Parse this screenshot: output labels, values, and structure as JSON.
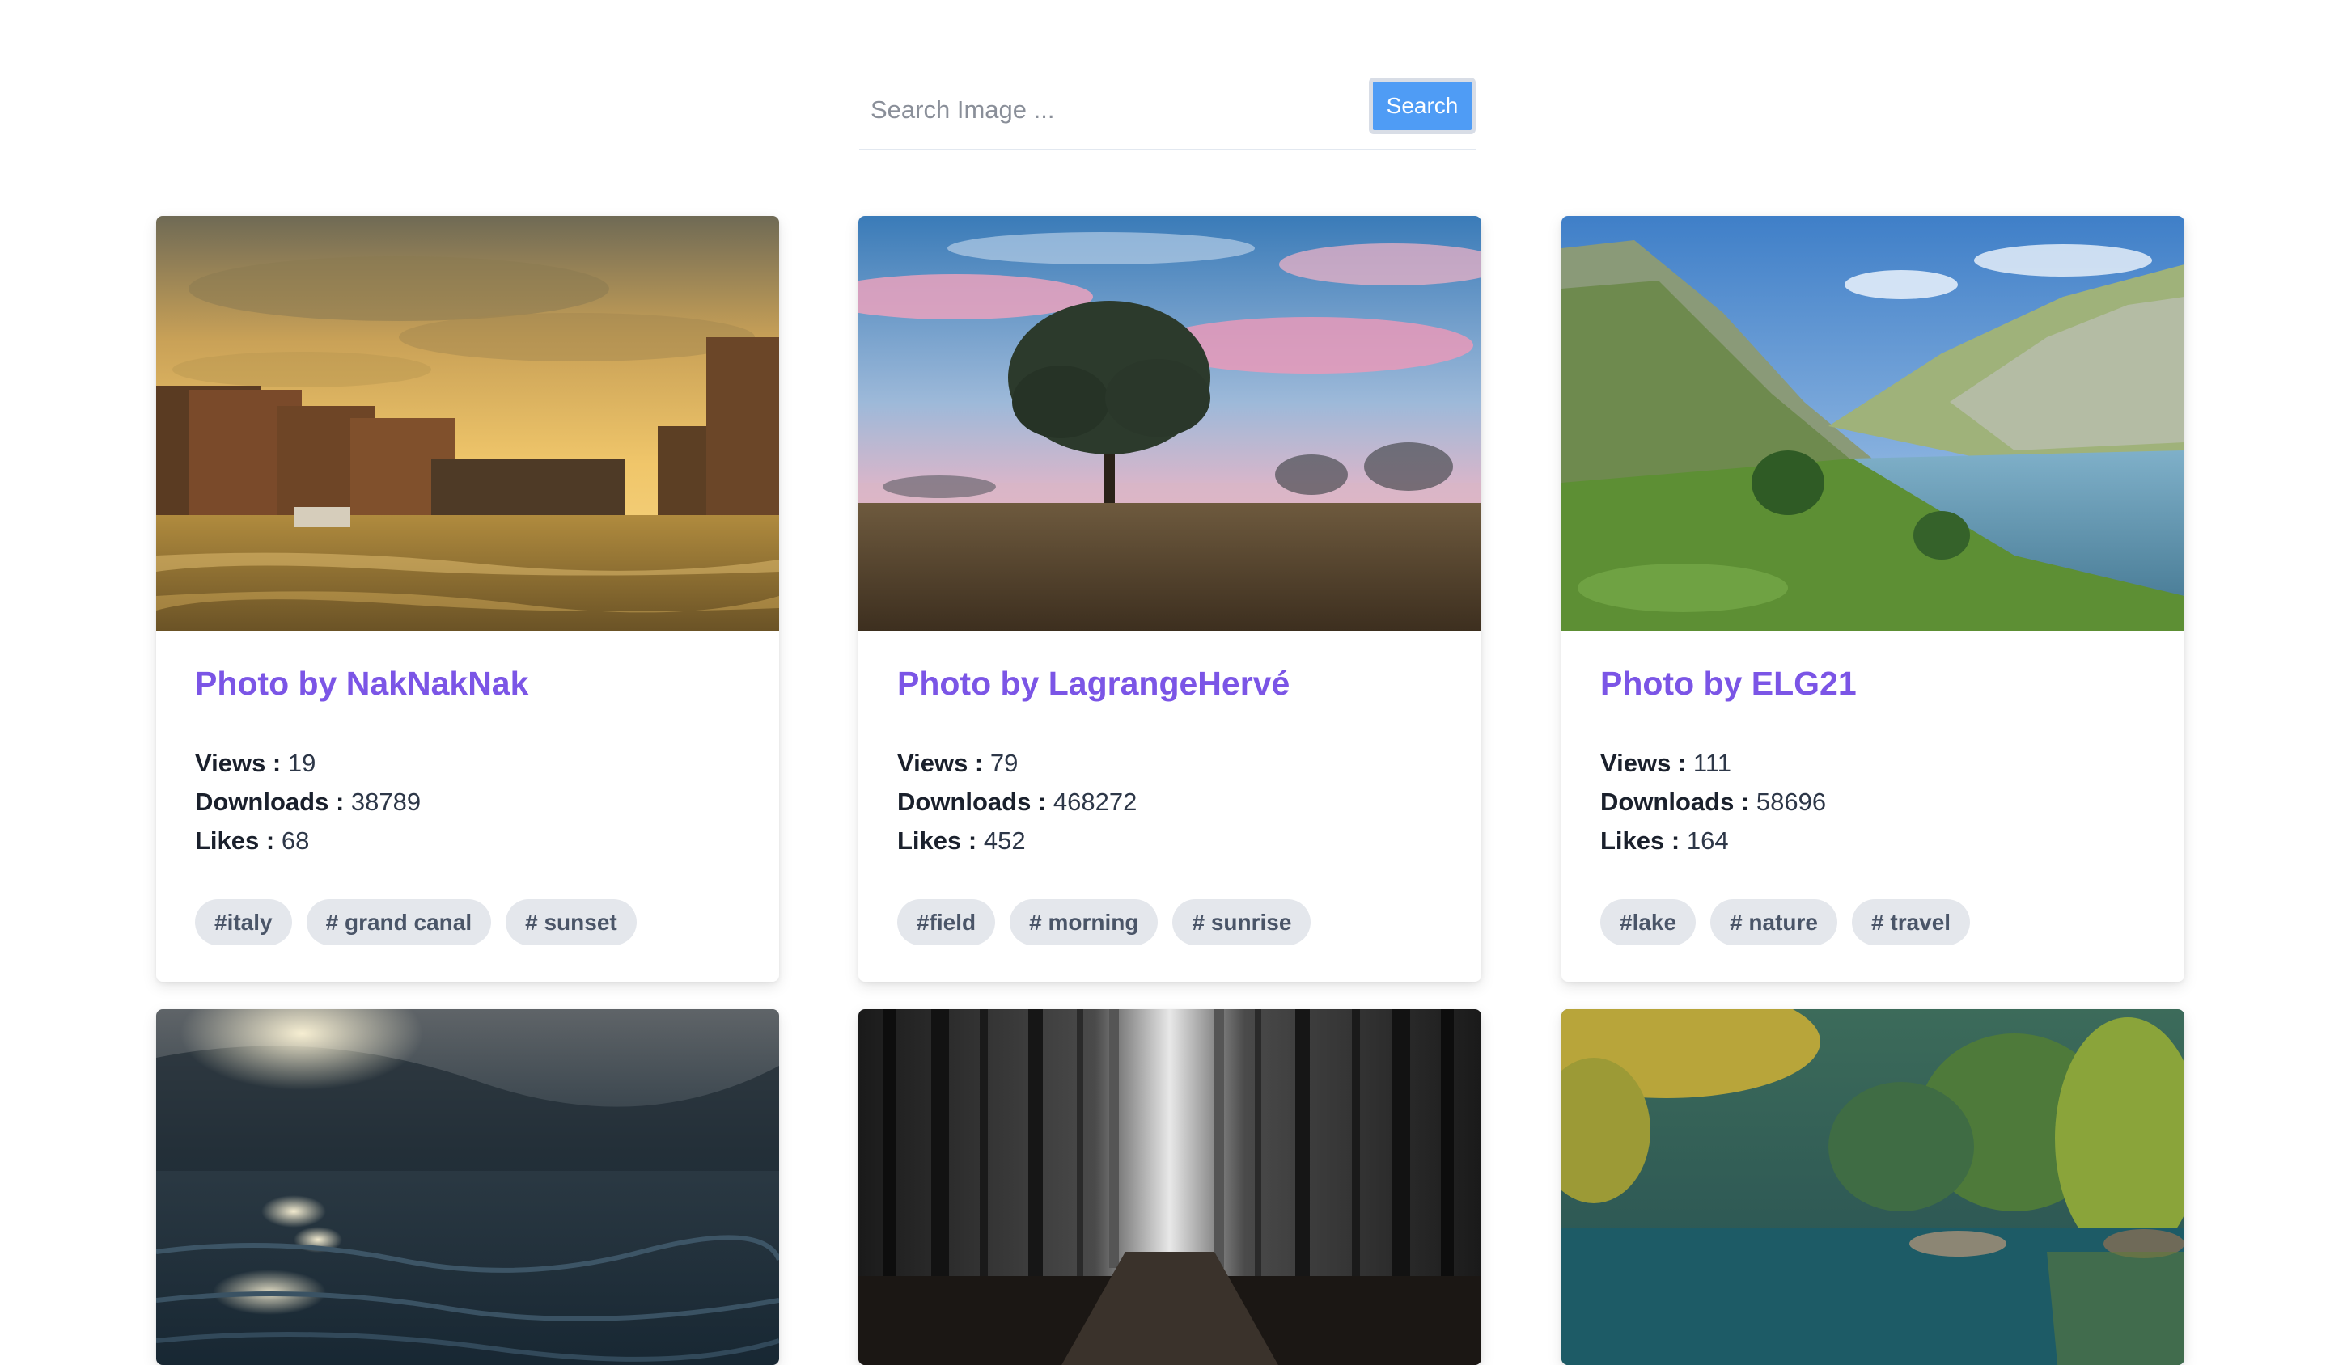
{
  "search": {
    "placeholder": "Search Image ...",
    "button_label": "Search"
  },
  "cards": [
    {
      "photo": "venice-canal-sunset",
      "title": "Photo by NakNakNak",
      "views_label": "Views :",
      "views": "19",
      "downloads_label": "Downloads :",
      "downloads": "38789",
      "likes_label": "Likes :",
      "likes": "68",
      "tags": [
        "#italy",
        "# grand canal",
        "# sunset"
      ]
    },
    {
      "photo": "tree-in-field-sunrise",
      "title": "Photo by LagrangeHervé",
      "views_label": "Views :",
      "views": "79",
      "downloads_label": "Downloads :",
      "downloads": "468272",
      "likes_label": "Likes :",
      "likes": "452",
      "tags": [
        "#field",
        "# morning",
        "# sunrise"
      ]
    },
    {
      "photo": "mountain-lake-green-hills",
      "title": "Photo by ELG21",
      "views_label": "Views :",
      "views": "111",
      "downloads_label": "Downloads :",
      "downloads": "58696",
      "likes_label": "Likes :",
      "likes": "164",
      "tags": [
        "#lake",
        "# nature",
        "# travel"
      ]
    },
    {
      "photo": "dark-water-sun-reflection"
    },
    {
      "photo": "dark-forest-path"
    },
    {
      "photo": "forest-lake-reflection"
    }
  ]
}
